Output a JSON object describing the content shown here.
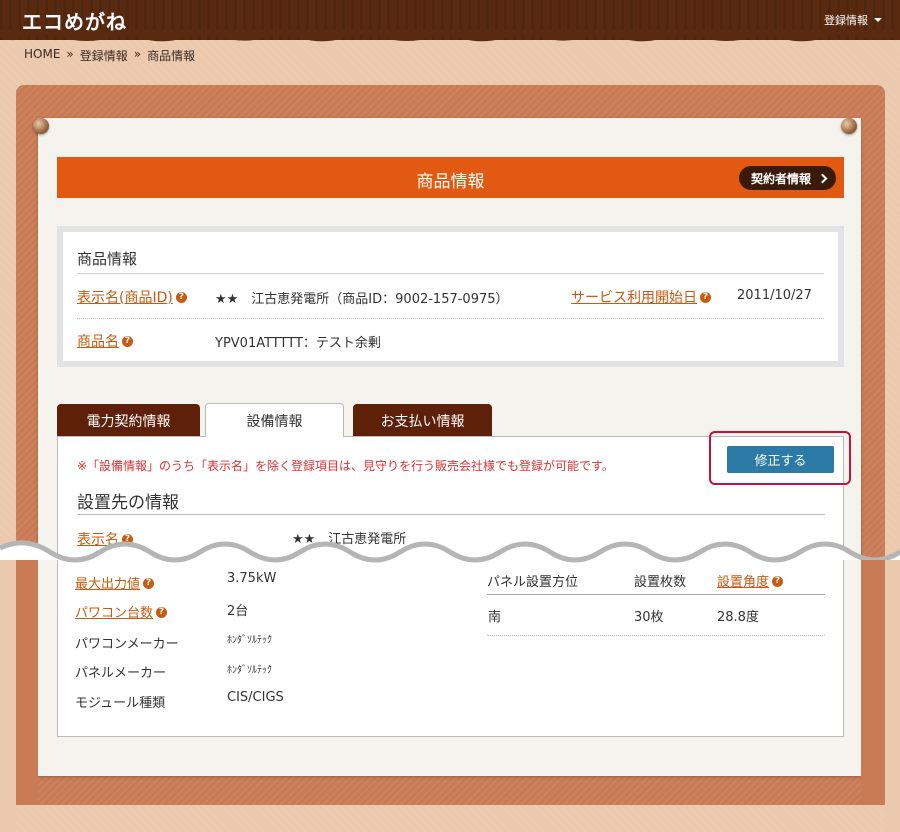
{
  "header": {
    "logo": "エコめがね",
    "account_menu": "登録情報"
  },
  "breadcrumb": {
    "home": "HOME",
    "sep": "»",
    "level1": "登録情報",
    "current": "商品情報"
  },
  "page": {
    "title": "商品情報",
    "contract_button": "契約者情報"
  },
  "product": {
    "heading": "商品情報",
    "display_name_label_pre": "表示名(",
    "display_name_label_link": "商品ID",
    "display_name_label_post": ")",
    "display_name_value": "★★　江古恵発電所（商品ID：9002-157-0975）",
    "service_start_label": "サービス利用開始日",
    "service_start_value": "2011/10/27",
    "product_name_label": "商品名",
    "product_name_value": "YPV01ATTTTT：テスト余剰"
  },
  "tabs": [
    {
      "label": "電力契約情報"
    },
    {
      "label": "設備情報"
    },
    {
      "label": "お支払い情報"
    }
  ],
  "equipment": {
    "notice": "※「設備情報」のうち「表示名」を除く登録項目は、見守りを行う販売会社様でも登録が可能です。",
    "edit_button": "修正する",
    "section_title": "設置先の情報",
    "display_name_label": "表示名",
    "display_name_value": "★★　江古恵発電所",
    "max_output_label": "最大出力値",
    "max_output_value": "3.75kW",
    "pcs_count_label": "パワコン台数",
    "pcs_count_value": "2台",
    "pcs_maker_label": "パワコンメーカー",
    "pcs_maker_value": "ﾎﾝﾀﾞｿﾙﾃｯｸ",
    "panel_maker_label": "パネルメーカー",
    "panel_maker_value": "ﾎﾝﾀﾞｿﾙﾃｯｸ",
    "module_label": "モジュール種類",
    "module_value": "CIS/CIGS",
    "panel_table": {
      "headers": [
        "パネル設置方位",
        "設置枚数",
        "設置角度"
      ],
      "rows": [
        [
          "南",
          "30枚",
          "28.8度"
        ]
      ]
    }
  }
}
